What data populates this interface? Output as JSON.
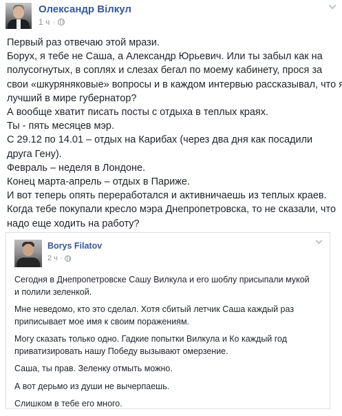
{
  "post": {
    "author": "Олександр Вілкул",
    "time": "1 ч",
    "lines": [
      "Первый раз отвечаю этой мрази.",
      "Борух, я тебе не Саша, а Александр Юрьевич. Или ты забыл как на",
      "полусогнутых, в соплях и слезах бегал по моему кабинету, прося за",
      "свои «шкуряняковые» вопросы и в каждом интервью рассказывал, что я",
      "лучший в мире губернатор?",
      "А вообще хватит писать посты с отдыха в теплых краях.",
      "Ты - пять месяцев мэр.",
      "С 29.12 по 14.01 – отдых на Карибах (через два дня как посадили",
      "друга Гену).",
      "Февраль – неделя в Лондоне.",
      "Конец марта-апрель – отдых в Париже.",
      "И вот теперь опять переработался и активничаешь из теплых краев.",
      "Когда тебе покупали кресло мэра Днепропетровска, то не сказали, что",
      "надо еще ходить на работу?"
    ]
  },
  "shared": {
    "author": "Borys Filatov",
    "time": "2 ч",
    "p1": [
      "Сегодня в Днепропетровске Сашу Вилкула и его шоблу присыпали мукой",
      "и полили зеленкой."
    ],
    "p2": [
      "Мне неведомо, кто это сделал. Хотя сбитый летчик Саша каждый раз",
      "приписывает мое имя к своим поражениям."
    ],
    "p3": [
      "Могу сказать только одно. Гадкие попытки Вилкула и Ко каждый год",
      "приватизировать нашу Победу вызывают омерзение."
    ],
    "p4": [
      "Саша, ты прав. Зеленку отмыть можно."
    ],
    "p5": [
      "А вот дерьмо из души не вычерпаешь."
    ],
    "p6": [
      "Слишком в тебе его много."
    ]
  }
}
